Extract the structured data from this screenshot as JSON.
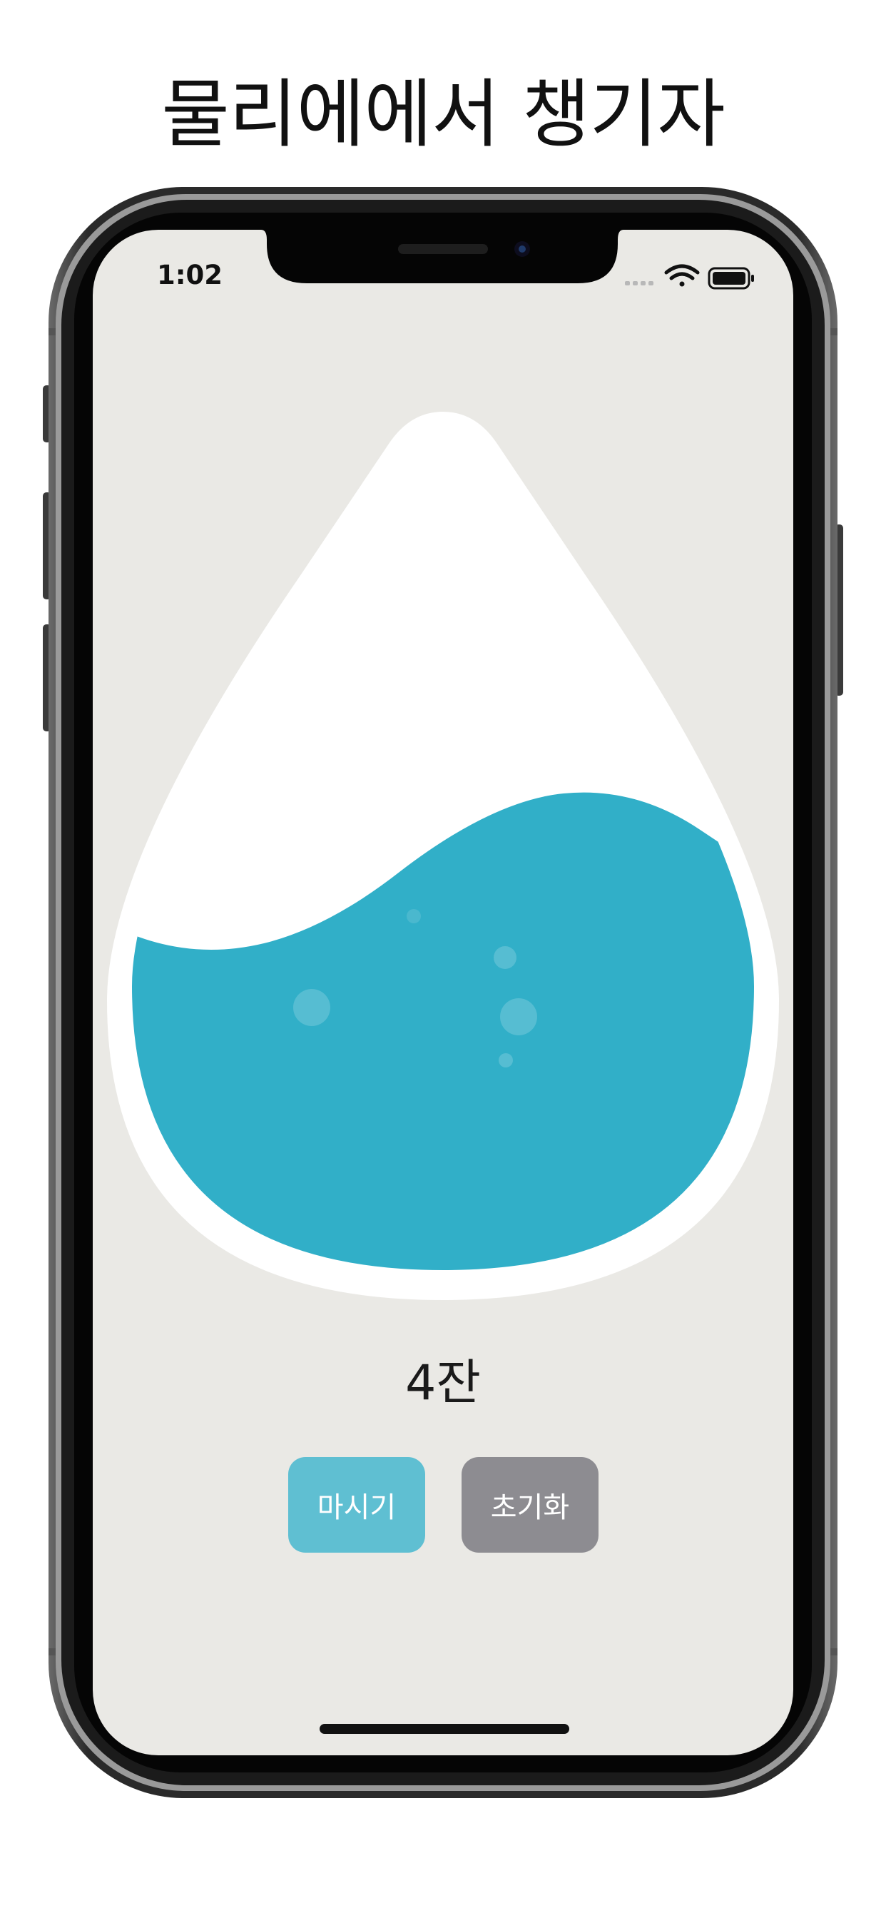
{
  "promo": {
    "title": "물리에에서 챙기자"
  },
  "status_bar": {
    "time": "1:02",
    "icons": [
      "signal-dots-icon",
      "wifi-icon",
      "battery-icon"
    ]
  },
  "water": {
    "fill_level": 0.58,
    "color": "#31afc8",
    "drop_color": "#ffffff"
  },
  "counter": {
    "text": "4잔"
  },
  "buttons": {
    "drink_label": "마시기",
    "drink_color": "#5fbfd2",
    "reset_label": "초기화",
    "reset_color": "#8d8c91"
  },
  "colors": {
    "screen_background": "#eae9e5",
    "frame": "#1b1b1b"
  }
}
